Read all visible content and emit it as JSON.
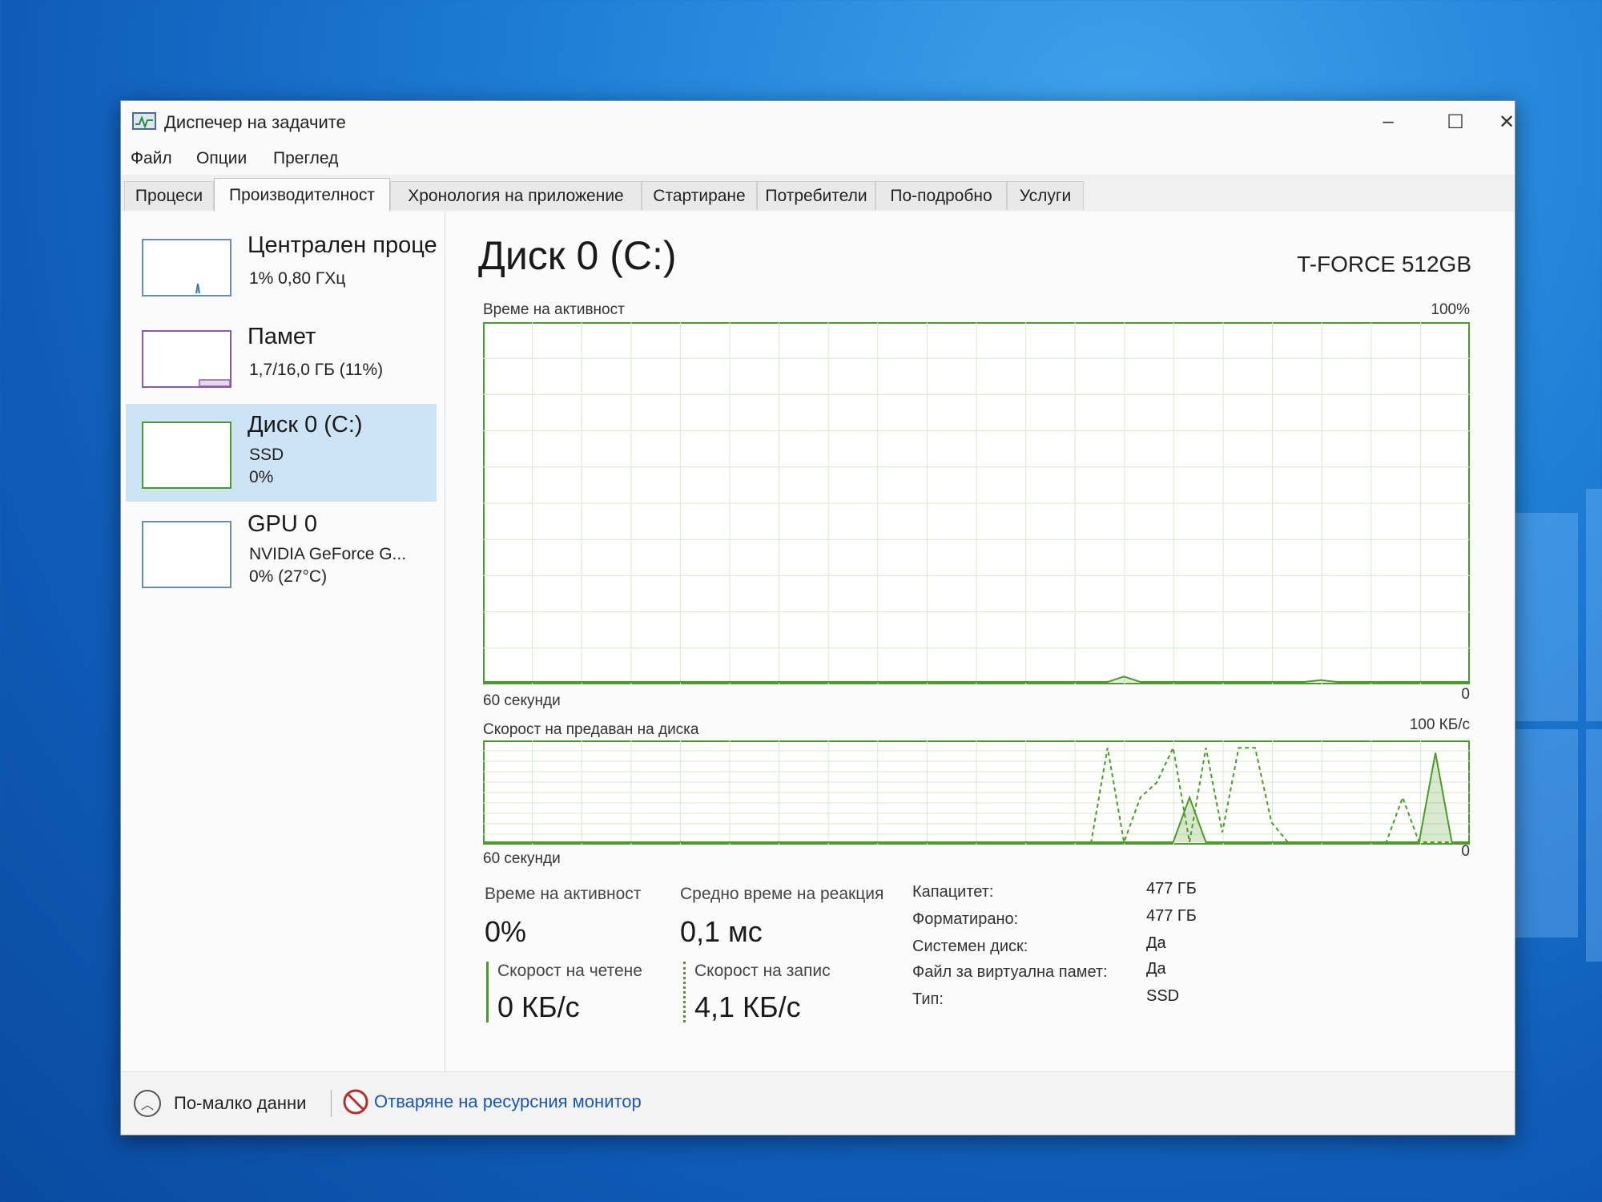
{
  "window": {
    "title": "Диспечер на задачите",
    "minimize": "–",
    "maximize": "☐",
    "close": "✕"
  },
  "menu": [
    "Файл",
    "Опции",
    "Преглед"
  ],
  "tabs": [
    "Процеси",
    "Производителност",
    "Хронология на приложение",
    "Стартиране",
    "Потребители",
    "По-подробно",
    "Услуги"
  ],
  "sidebar": [
    {
      "title": "Централен проце",
      "sub1": "1% 0,80 ГХц",
      "sub2": ""
    },
    {
      "title": "Памет",
      "sub1": "1,7/16,0 ГБ (11%)",
      "sub2": ""
    },
    {
      "title": "Диск 0 (C:)",
      "sub1": "SSD",
      "sub2": "0%"
    },
    {
      "title": "GPU 0",
      "sub1": "NVIDIA GeForce G...",
      "sub2": "0% (27°C)"
    }
  ],
  "main": {
    "title": "Диск 0 (C:)",
    "model": "T-FORCE 512GB",
    "chart1_label": "Време на активност",
    "chart1_max": "100%",
    "chart1_xlabel": "60 секунди",
    "chart1_min": "0",
    "chart2_label": "Скорост на предаван на диска",
    "chart2_max": "100 КБ/с",
    "chart2_xlabel": "60 секунди",
    "chart2_min": "0"
  },
  "stats": {
    "active_label": "Време на активност",
    "active_value": "0%",
    "response_label": "Средно време на реакция",
    "response_value": "0,1 мс",
    "read_label": "Скорост на четене",
    "read_value": "0 КБ/с",
    "write_label": "Скорост на запис",
    "write_value": "4,1 КБ/с"
  },
  "info": {
    "capacity_k": "Капацитет:",
    "capacity_v": "477 ГБ",
    "formatted_k": "Форматирано:",
    "formatted_v": "477 ГБ",
    "system_k": "Системен диск:",
    "system_v": "Да",
    "pagefile_k": "Файл за виртуална памет:",
    "pagefile_v": "Да",
    "type_k": "Тип:",
    "type_v": "SSD"
  },
  "footer": {
    "fewer": "По-малко данни",
    "resmon": "Отваряне на ресурсния монитор"
  },
  "colors": {
    "accent": "#4c9a2a",
    "selected": "#cde3f6",
    "thumb_border": "#6b8da6",
    "link": "#1a56b8"
  },
  "chart_data": [
    {
      "type": "area",
      "title": "Време на активност",
      "xlabel": "60 секунди",
      "ylim": [
        0,
        100
      ],
      "x": [
        0,
        1,
        2,
        3,
        4,
        5,
        6,
        7,
        8,
        9,
        10,
        11,
        12,
        13,
        14,
        15,
        16,
        17,
        18,
        19,
        20,
        21,
        22,
        23,
        24,
        25,
        26,
        27,
        28,
        29,
        30,
        31,
        32,
        33,
        34,
        35,
        36,
        37,
        38,
        39,
        40,
        41,
        42,
        43,
        44,
        45,
        46,
        47,
        48,
        49,
        50,
        51,
        52,
        53,
        54,
        55,
        56,
        57,
        58,
        59,
        60
      ],
      "series": [
        {
          "values": [
            0,
            0,
            0,
            0,
            0,
            0,
            0,
            0,
            0,
            0,
            0,
            0,
            0,
            0,
            0,
            0,
            0,
            0,
            0,
            0,
            0,
            0,
            0,
            0,
            0,
            0,
            0,
            0,
            0,
            0,
            0,
            0,
            0,
            0,
            0,
            0,
            0,
            0,
            0,
            1.5,
            0,
            0,
            0,
            0,
            0,
            0,
            0,
            0,
            0,
            0,
            0,
            0.5,
            0,
            0,
            0,
            0,
            0,
            0,
            0,
            0,
            0
          ]
        }
      ]
    },
    {
      "type": "area",
      "title": "Скорост на предаван на диска",
      "xlabel": "60 секунди",
      "ylim": [
        0,
        100
      ],
      "x": [
        0,
        1,
        2,
        3,
        4,
        5,
        6,
        7,
        8,
        9,
        10,
        11,
        12,
        13,
        14,
        15,
        16,
        17,
        18,
        19,
        20,
        21,
        22,
        23,
        24,
        25,
        26,
        27,
        28,
        29,
        30,
        31,
        32,
        33,
        34,
        35,
        36,
        37,
        38,
        39,
        40,
        41,
        42,
        43,
        44,
        45,
        46,
        47,
        48,
        49,
        50,
        51,
        52,
        53,
        54,
        55,
        56,
        57,
        58,
        59,
        60
      ],
      "series": [
        {
          "values": [
            0,
            0,
            0,
            0,
            0,
            0,
            0,
            0,
            0,
            0,
            0,
            0,
            0,
            0,
            0,
            0,
            0,
            0,
            0,
            0,
            0,
            0,
            0,
            0,
            0,
            0,
            0,
            0,
            0,
            0,
            0,
            0,
            0,
            0,
            0,
            0,
            0,
            0,
            0,
            0,
            0,
            0,
            0,
            45,
            0,
            0,
            0,
            0,
            0,
            0,
            0,
            0,
            0,
            0,
            0,
            0,
            0,
            0,
            90,
            0,
            0
          ]
        },
        {
          "values": [
            0,
            0,
            0,
            0,
            0,
            0,
            0,
            0,
            0,
            0,
            0,
            0,
            0,
            0,
            0,
            0,
            0,
            0,
            0,
            0,
            0,
            0,
            0,
            0,
            0,
            0,
            0,
            0,
            0,
            0,
            0,
            0,
            0,
            0,
            0,
            0,
            0,
            0,
            95,
            0,
            45,
            60,
            95,
            0,
            95,
            10,
            95,
            95,
            20,
            0,
            0,
            0,
            0,
            0,
            0,
            0,
            45,
            0,
            0,
            0,
            0
          ]
        }
      ]
    }
  ]
}
